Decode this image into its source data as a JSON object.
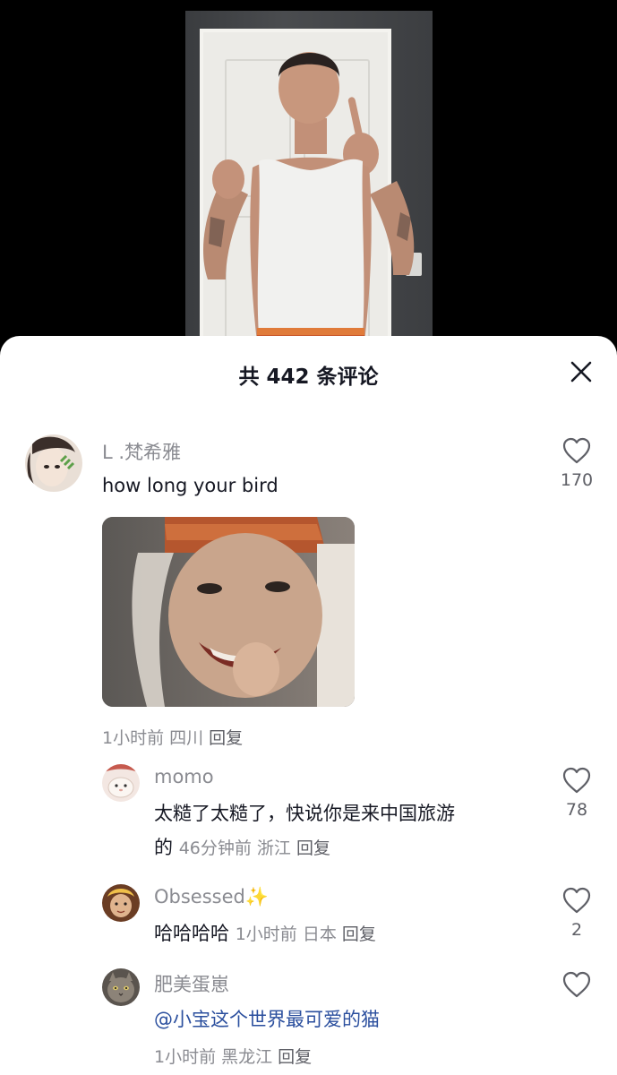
{
  "header": {
    "title": "共 442 条评论"
  },
  "comments": [
    {
      "username": "L .梵希雅",
      "text": "how long your bird",
      "likes": "170",
      "time": "1小时前",
      "location": "四川",
      "reply": "回复",
      "has_image": true
    },
    {
      "username": "momo",
      "text_line1": "太糙了太糙了，快说你是来中国旅游",
      "text_line2": "的",
      "likes": "78",
      "time": "46分钟前",
      "location": "浙江",
      "reply": "回复"
    },
    {
      "username": "Obsessed",
      "username_emoji": "✨",
      "text": "哈哈哈哈",
      "likes": "2",
      "time": "1小时前",
      "location": "日本",
      "reply": "回复"
    },
    {
      "username": "肥美蛋崽",
      "mention": "@小宝这个世界最可爱的猫",
      "time": "1小时前",
      "location": "黑龙江",
      "reply": "回复"
    }
  ],
  "colors": {
    "text_primary": "#161823",
    "text_secondary": "#8a8b91",
    "mention": "#2b4f9e",
    "sheet_bg": "#ffffff"
  }
}
